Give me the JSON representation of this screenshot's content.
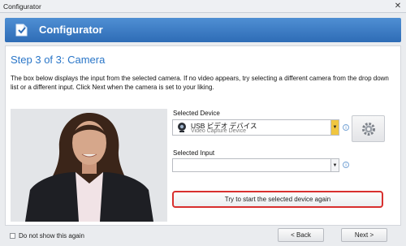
{
  "window": {
    "title": "Configurator",
    "close_glyph": "✕"
  },
  "banner": {
    "title": "Configurator",
    "logo_icon": "configurator-logo-icon"
  },
  "step": {
    "title": "Step 3 of 3: Camera",
    "description": "The box below displays the input from the selected camera. If no video appears, try selecting a different camera from the drop down list or a different input.  Click Next when the camera is set to your liking."
  },
  "device": {
    "label": "Selected Device",
    "name": "USB ビデオ デバイス",
    "subtitle": "Video Capture Device",
    "device_icon": "webcam-icon",
    "settings_icon": "gear-icon"
  },
  "input": {
    "label": "Selected Input",
    "value": ""
  },
  "retry_button": {
    "label": "Try to start the selected device again"
  },
  "footer": {
    "dont_show_label": "Do not show this again",
    "dont_show_checked": false,
    "back_label": "< Back",
    "next_label": "Next >"
  },
  "colors": {
    "banner": "#3a7bc8",
    "step_title": "#2a76c8",
    "retry_border": "#d8302f",
    "dropdown_arrow_active": "#f0c640"
  }
}
